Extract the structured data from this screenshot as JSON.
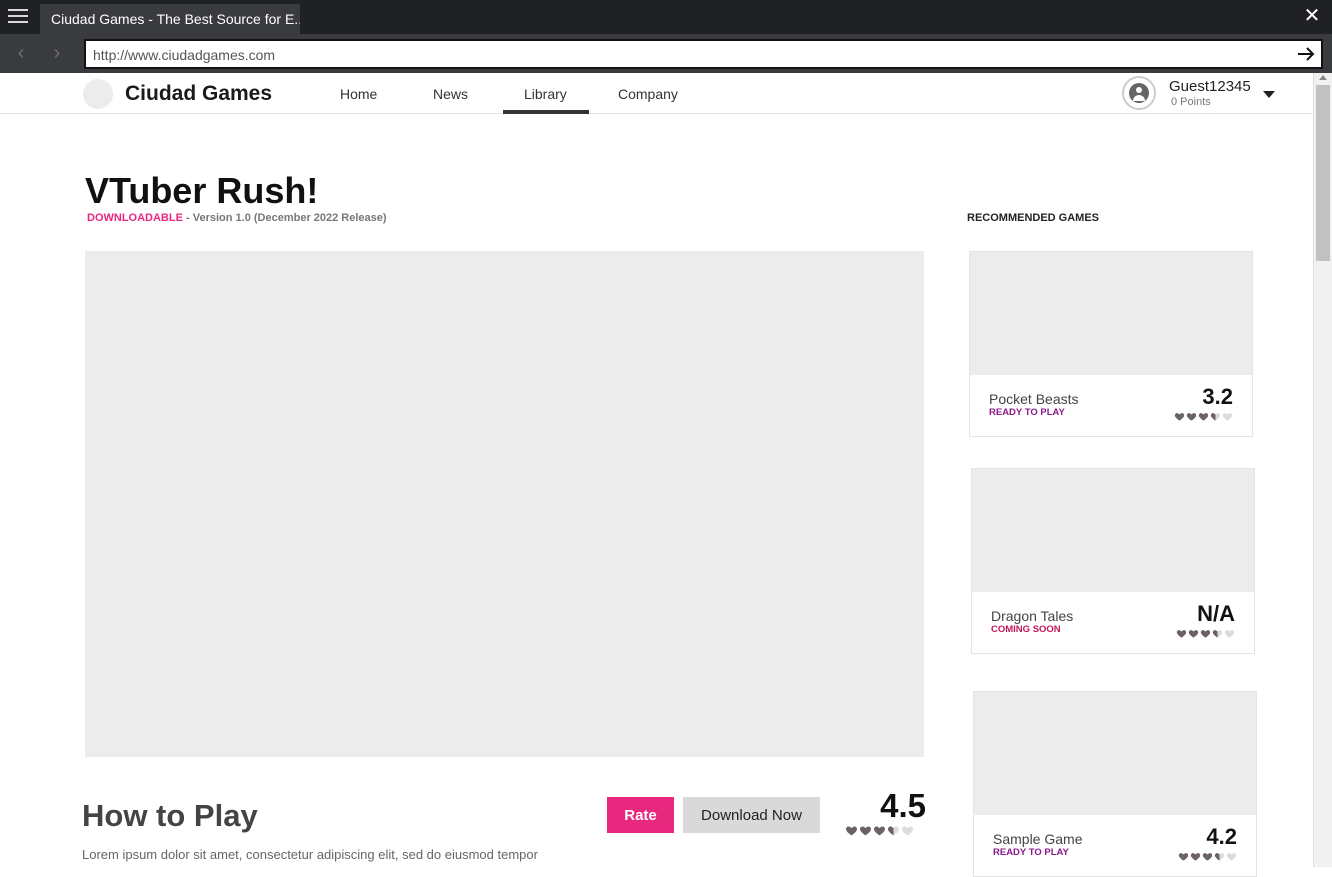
{
  "browser": {
    "tab_title": "Ciudad Games - The Best Source for E...",
    "url": "http://www.ciudadgames.com"
  },
  "site": {
    "brand": "Ciudad Games",
    "nav": [
      {
        "label": "Home"
      },
      {
        "label": "News"
      },
      {
        "label": "Library",
        "active": true
      },
      {
        "label": "Company"
      }
    ],
    "user": {
      "name": "Guest12345",
      "points": "0 Points"
    }
  },
  "game": {
    "title": "VTuber Rush!",
    "tag": "DOWNLOADABLE",
    "version": "- Version 1.0 (December 2022 Release)",
    "how_to_play": "How to Play",
    "description": "Lorem ipsum dolor sit amet, consectetur adipiscing elit, sed do eiusmod tempor",
    "rate_label": "Rate",
    "download_label": "Download Now",
    "score": "4.5",
    "hearts_filled": 3.5
  },
  "sidebar": {
    "title": "RECOMMENDED GAMES",
    "games": [
      {
        "name": "Pocket Beasts",
        "status": "READY TO PLAY",
        "status_color": "#8b1a8b",
        "score": "3.2",
        "hearts_filled": 3.5
      },
      {
        "name": "Dragon Tales",
        "status": "COMING SOON",
        "status_color": "#c2185b",
        "score": "N/A",
        "hearts_filled": 3.5
      },
      {
        "name": "Sample Game",
        "status": "READY TO PLAY",
        "status_color": "#8b1a8b",
        "score": "4.2",
        "hearts_filled": 3.5
      }
    ]
  },
  "colors": {
    "accent": "#e8287f",
    "heart_filled": "#6b6167",
    "heart_empty": "#dcdcdc"
  }
}
